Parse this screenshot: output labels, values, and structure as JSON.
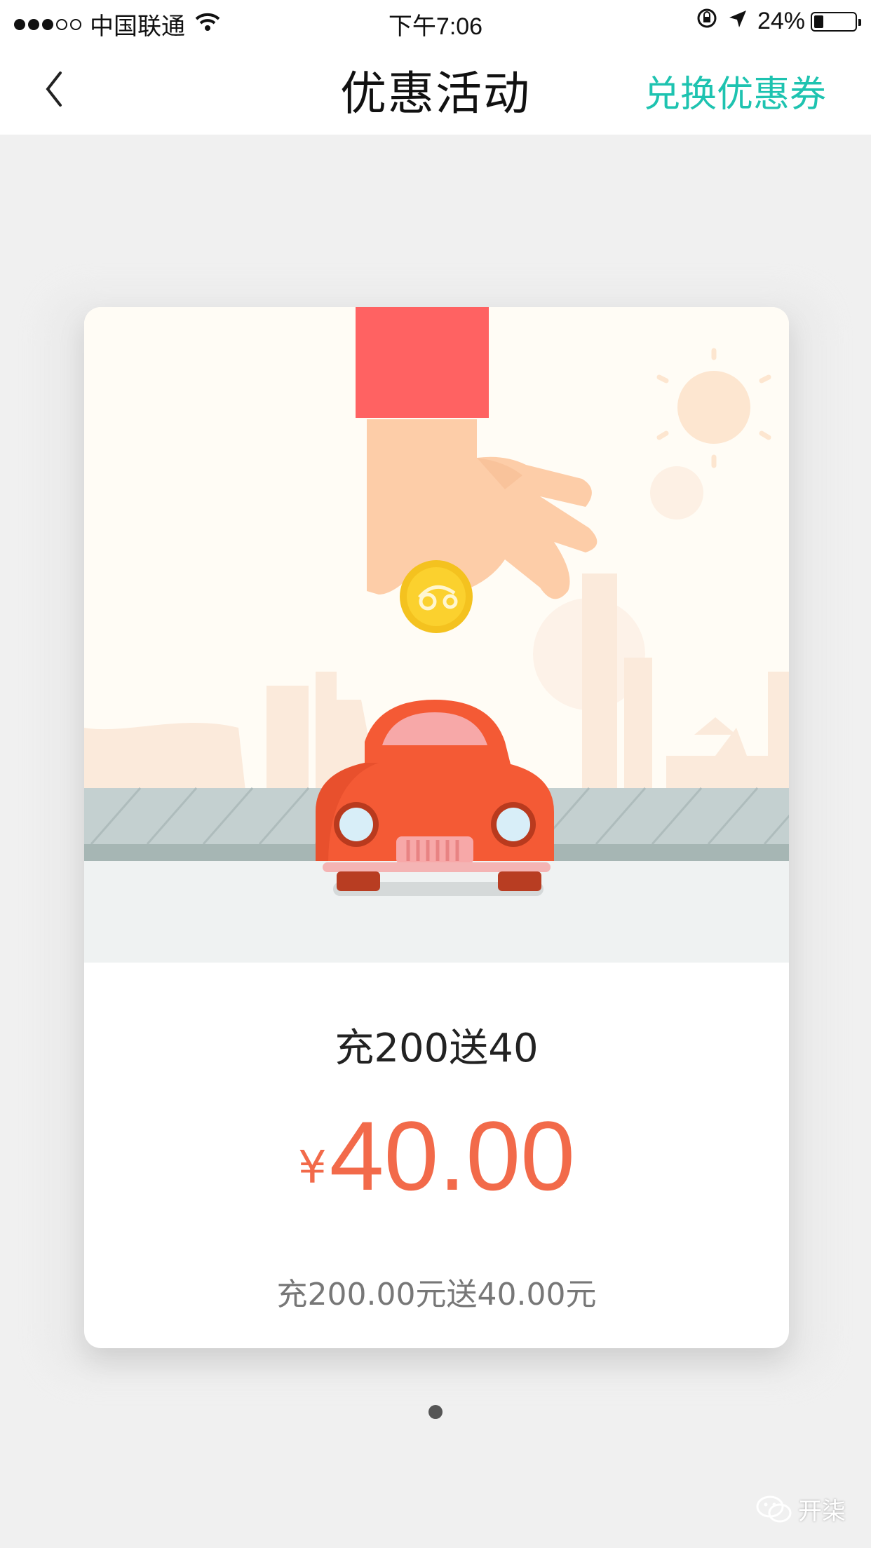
{
  "status_bar": {
    "carrier": "中国联通",
    "time": "下午7:06",
    "battery_text": "24%",
    "battery_level": 0.24,
    "signal_filled": 3,
    "signal_total": 5
  },
  "nav": {
    "title": "优惠活动",
    "action_label": "兑换优惠券",
    "accent_color": "#1ec3b0"
  },
  "promo_card": {
    "title": "充200送40",
    "currency_symbol": "¥",
    "amount": "40.00",
    "description": "充200.00元送40.00元",
    "price_color": "#f26a4a"
  },
  "pager": {
    "current": 1,
    "total": 1
  },
  "watermark": {
    "text": "开柒"
  }
}
